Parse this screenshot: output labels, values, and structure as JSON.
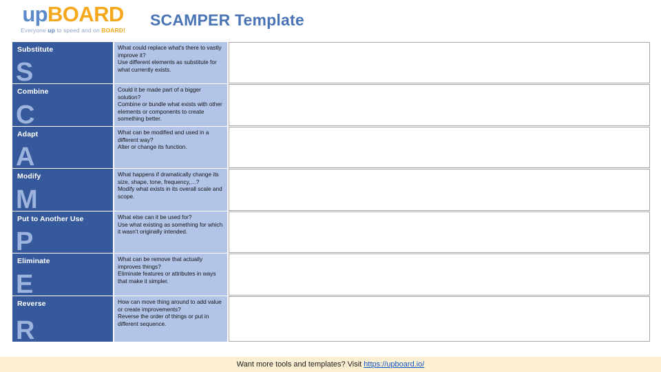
{
  "header": {
    "logo": {
      "text_up": "up",
      "text_board": "BOARD",
      "tagline_pre": "Everyone ",
      "tagline_up": "up",
      "tagline_mid": " to speed and on ",
      "tagline_board": "BOARD!"
    },
    "title": "SCAMPER Template"
  },
  "colors": {
    "letter_cell_bg": "#35599a",
    "letter_glyph": "#9cb4de",
    "desc_cell_bg": "#b2c4e8",
    "blank_cell_bg": "#ffffff",
    "blank_cell_border": "#a6a6a6",
    "title_blue": "#4a74b5",
    "logo_blue": "#5b89c9",
    "logo_orange": "#f5a81c",
    "footer_bg": "#fdf0d2",
    "footer_link": "#1155cc"
  },
  "rows": [
    {
      "word": "Substitute",
      "letter": "S",
      "question": "What could replace what's there to vastly improve it?",
      "action": "Use different elements as substitute for what currently exists.",
      "answer": ""
    },
    {
      "word": "Combine",
      "letter": "C",
      "question": "Could it be made part of a bigger solution?",
      "action": "Combine or bundle what exists with other elements or components to create something better.",
      "answer": ""
    },
    {
      "word": "Adapt",
      "letter": "A",
      "question": "What can be modified and used in a different way?",
      "action": "Alter or change its function.",
      "answer": ""
    },
    {
      "word": "Modify",
      "letter": "M",
      "question": "What happens if dramatically change its size, shape, tone, frequency,…?",
      "action": "Modify what exists in its overall scale and scope.",
      "answer": ""
    },
    {
      "word": "Put to Another Use",
      "letter": "P",
      "question": "What else can it be used for?",
      "action": "Use what existing as something for which it wasn't originally intended.",
      "answer": ""
    },
    {
      "word": "Eliminate",
      "letter": "E",
      "question": "What can be remove that actually improves things?",
      "action": "Eliminate features or attributes in ways that make it simpler.",
      "answer": ""
    },
    {
      "word": "Reverse",
      "letter": "R",
      "question": "How can move thing around to add value or create improvements?",
      "action": "Reverse the order of things or put in different sequence.",
      "answer": ""
    }
  ],
  "footer": {
    "text": "Want more tools and templates? Visit ",
    "link_text": "https://upboard.io/"
  }
}
